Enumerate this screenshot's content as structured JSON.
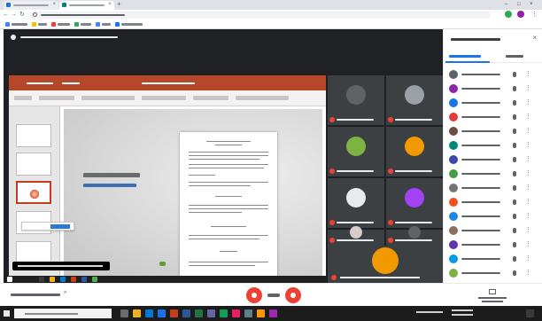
{
  "browser": {
    "tabs": [
      {
        "title": "",
        "favicon_color": "#1a73e8"
      },
      {
        "title": "",
        "favicon_color": "#00897b"
      }
    ],
    "address": {
      "url": ""
    },
    "bookmarks": [
      {
        "label": "",
        "icon_color": "#4285f4"
      },
      {
        "label": "",
        "icon_color": "#fbbc04"
      },
      {
        "label": "",
        "icon_color": "#ea4335"
      },
      {
        "label": "",
        "icon_color": "#34a853"
      },
      {
        "label": "",
        "icon_color": "#4285f4"
      },
      {
        "label": "",
        "icon_color": "#1a73e8"
      }
    ]
  },
  "meet": {
    "presenting_banner": "",
    "presentation": {
      "slide_title": "",
      "slide_link": "",
      "caption": ""
    },
    "tiles": [
      {
        "name": "",
        "avatar_color": "#5f6368"
      },
      {
        "name": "",
        "avatar_color": "#9aa0a6"
      },
      {
        "name": "",
        "avatar_color": "#7cb342"
      },
      {
        "name": "",
        "avatar_color": "#f29900"
      },
      {
        "name": "",
        "avatar_color": "#e8eaed"
      },
      {
        "name": "",
        "avatar_color": "#a142f4"
      },
      {
        "name": "",
        "avatar_color": "#d7ccc8"
      },
      {
        "name": "",
        "avatar_color": "#5f6368"
      }
    ],
    "big_tile": {
      "name": "",
      "avatar_color": "#f29900"
    },
    "controls": {
      "meeting_details": ""
    },
    "sidebar": {
      "title": "",
      "tab_people": "",
      "tab_chat": "",
      "participants": [
        {
          "name": "",
          "avatar_color": "#5f6368"
        },
        {
          "name": "",
          "avatar_color": "#8e24aa"
        },
        {
          "name": "",
          "avatar_color": "#1a73e8"
        },
        {
          "name": "",
          "avatar_color": "#e53935"
        },
        {
          "name": "",
          "avatar_color": "#6d4c41"
        },
        {
          "name": "",
          "avatar_color": "#00897b"
        },
        {
          "name": "",
          "avatar_color": "#3949ab"
        },
        {
          "name": "",
          "avatar_color": "#43a047"
        },
        {
          "name": "",
          "avatar_color": "#757575"
        },
        {
          "name": "",
          "avatar_color": "#f4511e"
        },
        {
          "name": "",
          "avatar_color": "#1e88e5"
        },
        {
          "name": "",
          "avatar_color": "#8d6e63"
        },
        {
          "name": "",
          "avatar_color": "#5e35b1"
        },
        {
          "name": "",
          "avatar_color": "#039be5"
        },
        {
          "name": "",
          "avatar_color": "#7cb342"
        }
      ]
    }
  },
  "taskbar": {
    "search_placeholder": ""
  }
}
